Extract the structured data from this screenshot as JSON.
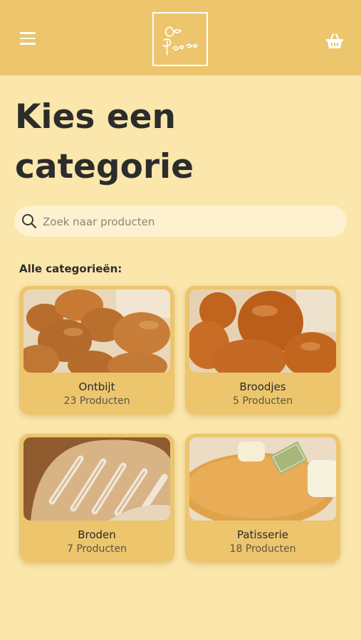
{
  "header": {
    "logo_text": "De Baere",
    "menu_icon": "hamburger-menu-icon",
    "cart_icon": "shopping-basket-icon",
    "background_color": "#ecc56d"
  },
  "page": {
    "title_line1": "Kies een",
    "title_line2": "categorie",
    "background_color": "#fbe6ab"
  },
  "search": {
    "placeholder": "Zoek naar producten",
    "value": "",
    "icon": "search-icon"
  },
  "categories_label": "Alle categorieën:",
  "categories": [
    {
      "name": "Ontbijt",
      "count": "23 Producten"
    },
    {
      "name": "Broodjes",
      "count": "5 Producten"
    },
    {
      "name": "Broden",
      "count": "7 Producten"
    },
    {
      "name": "Patisserie",
      "count": "18 Producten"
    }
  ]
}
